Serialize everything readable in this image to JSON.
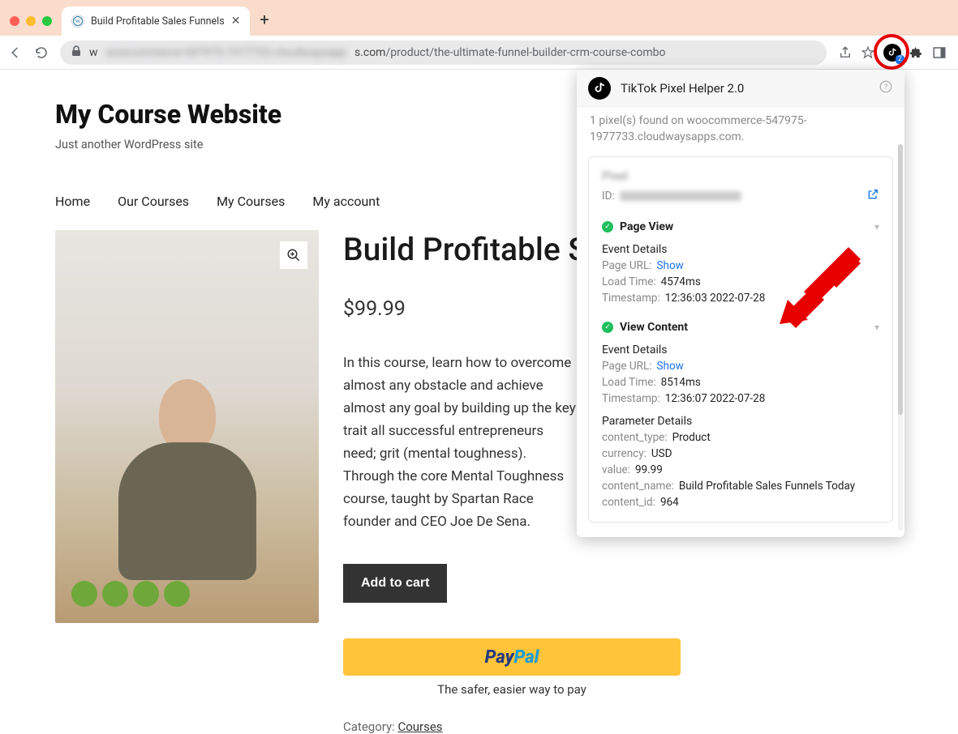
{
  "browser": {
    "tab_title": "Build Profitable Sales Funnels",
    "url_host_prefix": "w",
    "url_domain_suffix": "s.com",
    "url_path": "/product/the-ultimate-funnel-builder-crm-course-combo",
    "ext_badge": "2"
  },
  "site": {
    "title": "My Course Website",
    "tagline": "Just another WordPress site"
  },
  "menu": [
    "Home",
    "Our Courses",
    "My Courses",
    "My account"
  ],
  "product": {
    "title": "Build Profitable Sales Funnels Today",
    "price": "$99.99",
    "description": "In this course, learn how to overcome almost any obstacle and achieve almost any goal by building up the key trait all successful entrepreneurs need; grit (mental toughness). Through the core Mental Toughness course, taught by Spartan Race founder and CEO Joe De Sena.",
    "add_to_cart": "Add to cart",
    "paypal_pay": "Pay",
    "paypal_pal": "Pal",
    "safer": "The safer, easier way to pay",
    "category_label": "Category: ",
    "category_value": "Courses"
  },
  "popup": {
    "title": "TikTok Pixel Helper 2.0",
    "found": "1 pixel(s) found on woocommerce-547975-1977733.cloudwaysapps.com.",
    "id_label": "ID:",
    "events": [
      {
        "name": "Page View",
        "details_label": "Event Details",
        "page_url_k": "Page URL:",
        "page_url_v": "Show",
        "load_k": "Load Time:",
        "load_v": "4574ms",
        "ts_k": "Timestamp:",
        "ts_v": "12:36:03 2022-07-28"
      },
      {
        "name": "View Content",
        "details_label": "Event Details",
        "page_url_k": "Page URL:",
        "page_url_v": "Show",
        "load_k": "Load Time:",
        "load_v": "8514ms",
        "ts_k": "Timestamp:",
        "ts_v": "12:36:07 2022-07-28",
        "param_label": "Parameter Details",
        "params": {
          "content_type_k": "content_type:",
          "content_type_v": "Product",
          "currency_k": "currency:",
          "currency_v": "USD",
          "value_k": "value:",
          "value_v": "99.99",
          "content_name_k": "content_name:",
          "content_name_v": "Build Profitable Sales Funnels Today",
          "content_id_k": "content_id:",
          "content_id_v": "964"
        }
      }
    ]
  }
}
